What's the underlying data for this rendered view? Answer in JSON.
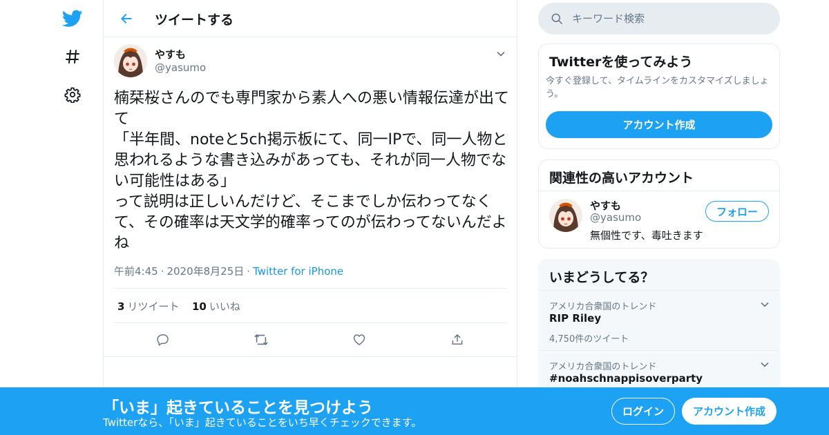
{
  "colors": {
    "accent": "#1da1f2",
    "text_primary": "#14171a",
    "text_secondary": "#657786",
    "link": "#1b95e0",
    "border": "#e6ecf0"
  },
  "nav": {
    "logo_icon": "twitter-bird-icon",
    "explore_icon": "hashtag-icon",
    "settings_icon": "gear-icon"
  },
  "header": {
    "back_icon": "back-arrow-icon",
    "title": "ツイートする"
  },
  "tweet": {
    "author_name": "やすも",
    "author_handle": "@yasumo",
    "text": "楠栞桜さんのでも専門家から素人への悪い情報伝達が出てて\n「半年間、noteと5ch掲示板にて、同一IPで、同一人物と思われるような書き込みがあっても、それが同一人物でない可能性はある」\nって説明は正しいんだけど、そこまでしか伝わってなくて、その確率は天文学的確率ってのが伝わってないんだよね",
    "time": "午前4:45",
    "date": "2020年8月25日",
    "source": "Twitter for iPhone",
    "retweet_count": "3",
    "retweet_label": "リツイート",
    "like_count": "10",
    "like_label": "いいね"
  },
  "search": {
    "placeholder": "キーワード検索"
  },
  "signup_card": {
    "title": "Twitterを使ってみよう",
    "description": "今すぐ登録して、タイムラインをカスタマイズしましょう。",
    "button": "アカウント作成"
  },
  "related_card": {
    "title": "関連性の高いアカウント",
    "account": {
      "name": "やすも",
      "handle": "@yasumo",
      "bio": "無個性です、毒吐きます",
      "follow_label": "フォロー"
    }
  },
  "trends_card": {
    "title": "いまどうしてる？",
    "items": [
      {
        "context": "アメリカ合衆国のトレンド",
        "name": "RIP Riley",
        "count": "4,750件のツイート"
      },
      {
        "context": "アメリカ合衆国のトレンド",
        "name": "#noahschnappisoverparty",
        "count": ""
      }
    ]
  },
  "bottom_bar": {
    "title": "「いま」起きていることを見つけよう",
    "subtitle": "Twitterなら、「いま」起きていることをいち早くチェックできます。",
    "login_label": "ログイン",
    "signup_label": "アカウント作成"
  }
}
